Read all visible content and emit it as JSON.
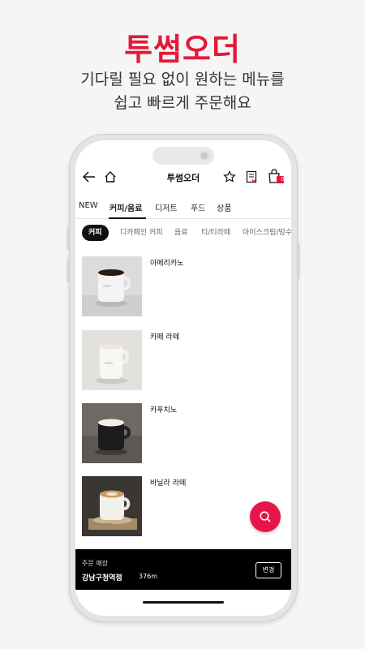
{
  "promo": {
    "title": "투썸오더",
    "subtitle_line1": "기다릴 필요 없이 원하는 메뉴를",
    "subtitle_line2": "쉽고 빠르게 주문해요"
  },
  "app": {
    "title": "투썸오더",
    "cart_count": "0"
  },
  "tabs": [
    {
      "label": "NEW",
      "active": false
    },
    {
      "label": "커피/음료",
      "active": true
    },
    {
      "label": "디저트",
      "active": false
    },
    {
      "label": "푸드",
      "active": false
    },
    {
      "label": "상품",
      "active": false
    }
  ],
  "subcategories": [
    {
      "label": "커피",
      "active": true
    },
    {
      "label": "디카페인 커피",
      "active": false
    },
    {
      "label": "음료",
      "active": false
    },
    {
      "label": "티/티라떼",
      "active": false
    },
    {
      "label": "아이스크림/빙수",
      "active": false
    }
  ],
  "menu": [
    {
      "name": "아메리카노"
    },
    {
      "name": "카페 라떼"
    },
    {
      "name": "카푸치노"
    },
    {
      "name": "바닐라 라떼"
    }
  ],
  "store": {
    "label": "주문 매장",
    "name": "강남구청역점",
    "distance": "376m",
    "change_label": "변경"
  },
  "colors": {
    "brand_red": "#e31937",
    "fab_pink": "#e8154b"
  }
}
